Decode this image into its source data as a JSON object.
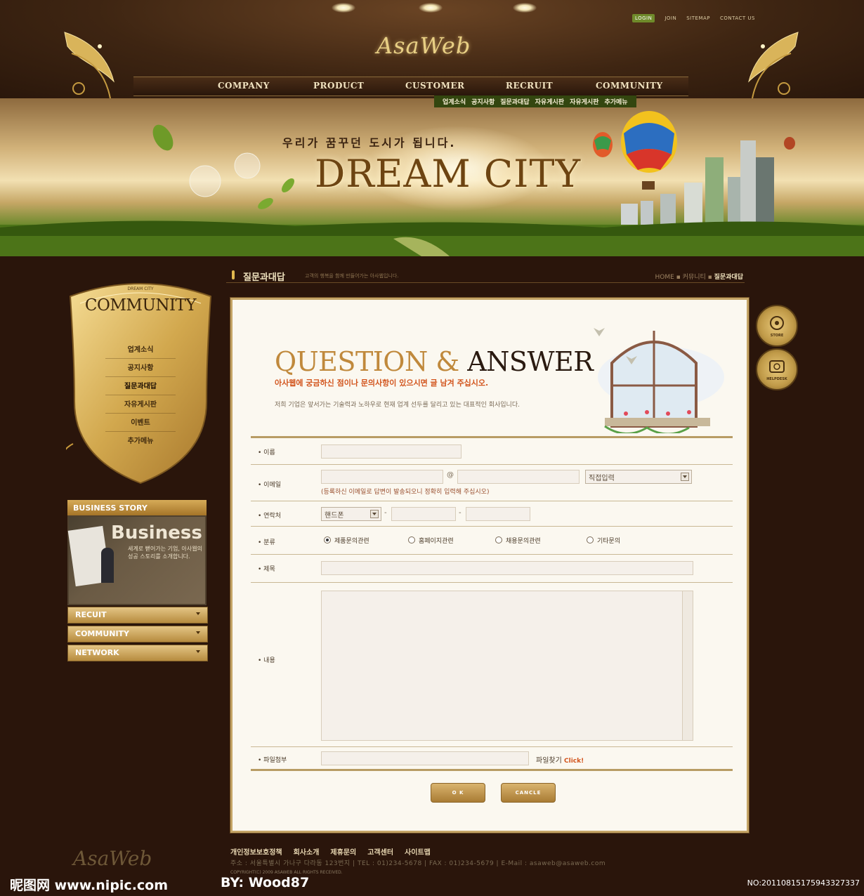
{
  "header": {
    "logo": "AsaWeb",
    "top_links": [
      "LOGIN",
      "JOIN",
      "SITEMAP",
      "CONTACT US"
    ],
    "gnb": [
      "COMPANY",
      "PRODUCT",
      "CUSTOMER",
      "RECRUIT",
      "COMMUNITY"
    ],
    "subnav": [
      "업계소식",
      "공지사항",
      "질문과대답",
      "자유게시판",
      "자유게시판",
      "추가메뉴"
    ]
  },
  "banner": {
    "caption": "우리가 꿈꾸던 도시가 됩니다.",
    "title": "DREAM CITY"
  },
  "section": {
    "title": "질문과대답",
    "desc": "고객의 행복을 함께 만들어가는 아사웹입니다.",
    "breadcrumb_home": "HOME",
    "breadcrumb_mid": "커뮤니티",
    "breadcrumb_current": "질문과대답"
  },
  "sidebar": {
    "top_label": "DREAM CITY",
    "title": "COMMUNITY",
    "items": [
      "업계소식",
      "공지사항",
      "질문과대답",
      "자유게시판",
      "이벤트",
      "추가메뉴"
    ],
    "business_story": {
      "title": "BUSINESS STORY",
      "big": "Business",
      "sub": "세계로 뻗어가는 기업, 아사웹의 성공 스토리를 소개합니다."
    },
    "quick": [
      "RECUIT",
      "COMMUNITY",
      "NETWORK"
    ]
  },
  "right_buttons": [
    "STORE",
    "HELPDESK"
  ],
  "qa": {
    "title_q": "QUESTION",
    "title_amp": "&",
    "title_a": "ANSWER",
    "subtitle": "아사웹에 궁금하신 점이나 문의사항이 있으시면 글 남겨 주십시오.",
    "desc": "저희 기업은 앞서가는 기술력과 노하우로 현재 업계 선두를 달리고 있는 대표적인 회사입니다."
  },
  "form": {
    "name_label": "• 이름",
    "email_label": "• 이메일",
    "email_at": "@",
    "email_select": "직접입력",
    "email_note": "(등록하신 이메일로 답변이 발송되오니 정확히 입력해 주십시오)",
    "phone_label": "• 연락처",
    "phone_select": "핸드폰",
    "phone_dash": "-",
    "category_label": "• 분류",
    "categories": [
      "제품문의관련",
      "홈페이지관련",
      "채용문의관련",
      "기타문의"
    ],
    "category_selected": 0,
    "subject_label": "• 제목",
    "content_label": "• 내용",
    "file_label": "• 파일첨부",
    "file_find": "파일찾기",
    "file_click": "Click!",
    "ok": "O K",
    "cancel": "CANCLE"
  },
  "footer": {
    "logo": "AsaWeb",
    "links": [
      "개인정보보호정책",
      "회사소개",
      "제휴문의",
      "고객센터",
      "사이트맵"
    ],
    "address": "주소 : 서울특별시 가나구 다라동 123번지   |   TEL : 01)234-5678   |   FAX : 01)234-5679   |   E-Mail : asaweb@asaweb.com",
    "copyright": "COPYRIGHT(C) 2009 ASAWEB ALL RIGHTS RECEIVED."
  },
  "watermark": {
    "left": "昵图网 www.nipic.com",
    "by": "BY: Wood87",
    "no": "NO:20110815175943327337"
  },
  "colors": {
    "background": "#2a150b",
    "accent_gold": "#c4a466",
    "subnav_green": "#33460f",
    "subtitle_orange": "#d2541c"
  }
}
